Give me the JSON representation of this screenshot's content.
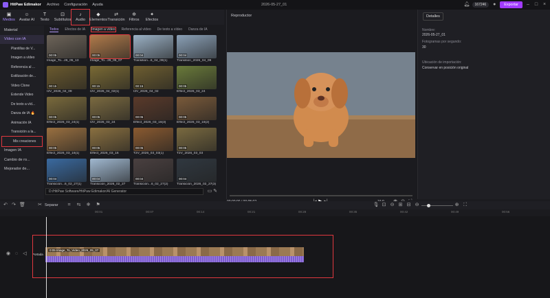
{
  "app": {
    "name": "HitPaw Edimakor",
    "menus": [
      "Archivo",
      "Configuración",
      "Ayuda"
    ],
    "project_title": "2026-05-27_01",
    "credits": "167246",
    "export_label": "Exportar"
  },
  "toolbar": {
    "tools": [
      {
        "label": "Medios",
        "icon": "media-icon"
      },
      {
        "label": "Avatar AI",
        "icon": "avatar-icon"
      },
      {
        "label": "Texto",
        "icon": "text-icon"
      },
      {
        "label": "Subtítulos",
        "icon": "subtitles-icon"
      },
      {
        "label": "Audio",
        "icon": "audio-icon"
      },
      {
        "label": "Elementos",
        "icon": "elements-icon"
      },
      {
        "label": "Transición",
        "icon": "transition-icon"
      },
      {
        "label": "Filtros",
        "icon": "filters-icon"
      },
      {
        "label": "Efectos",
        "icon": "effects-icon"
      }
    ]
  },
  "sidebar": {
    "items": [
      {
        "label": "Material",
        "level": "top"
      },
      {
        "label": "Vídeo con IA",
        "level": "top"
      },
      {
        "label": "Plantillas de V...",
        "level": "sub"
      },
      {
        "label": "Imagen a vídeo",
        "level": "sub"
      },
      {
        "label": "Referencia al ...",
        "level": "sub"
      },
      {
        "label": "Estilización de...",
        "level": "sub"
      },
      {
        "label": "Video Clone",
        "level": "sub"
      },
      {
        "label": "Extende Video",
        "level": "sub"
      },
      {
        "label": "De texto a víd...",
        "level": "sub"
      },
      {
        "label": "Danza de IA 🔥",
        "level": "sub"
      },
      {
        "label": "Animación IA",
        "level": "sub"
      },
      {
        "label": "Transición a la...",
        "level": "sub"
      },
      {
        "label": "Mis creaciones",
        "level": "sub"
      },
      {
        "label": "Imagen IA",
        "level": "top"
      },
      {
        "label": "Cambio de ro...",
        "level": "top"
      },
      {
        "label": "Mejorador de...",
        "level": "top"
      }
    ]
  },
  "subtabs": [
    "Todos",
    "Efectos de IA",
    "Imagen a vídeo",
    "Referencia al vídeo",
    "De texto a vídeo",
    "Danza de IA"
  ],
  "media": [
    {
      "dur": "00:05",
      "name": "Image_To...26_05_13",
      "color": "#6d6459"
    },
    {
      "dur": "00:05",
      "name": "Image_To...26_05_07",
      "color": "#b07a4a"
    },
    {
      "dur": "00:04",
      "name": "Transition...6_04_09(1)",
      "color": "#9ab0c4"
    },
    {
      "dur": "00:04",
      "name": "Transition_2026_04_09",
      "color": "#8aa0b6"
    },
    {
      "dur": "00:15",
      "name": "I2V_2026_04_09",
      "color": "#6b5a2e"
    },
    {
      "dur": "00:15",
      "name": "I2V_2026_04_02(1)",
      "color": "#7a6a34"
    },
    {
      "dur": "00:15",
      "name": "I2V_2026_04_02",
      "color": "#6e5e30"
    },
    {
      "dur": "00:05",
      "name": "Effect_2026_03_24",
      "color": "#6a7a3a"
    },
    {
      "dur": "00:05",
      "name": "Effect_2026_03_24(1)",
      "color": "#7a6a3c"
    },
    {
      "dur": "00:05",
      "name": "I2V_2026_03_24",
      "color": "#7b6a40"
    },
    {
      "dur": "00:05",
      "name": "Effect_2026_03_16(3)",
      "color": "#5a3a2a"
    },
    {
      "dur": "00:05",
      "name": "Effect_2026_03_16(2)",
      "color": "#7a5a3a"
    },
    {
      "dur": "00:05",
      "name": "Effect_2026_03_16(1)",
      "color": "#9a7040"
    },
    {
      "dur": "00:05",
      "name": "Effect_2026_03_16",
      "color": "#8a7040"
    },
    {
      "dur": "00:05",
      "name": "T2V_2026_03_03(1)",
      "color": "#8a5a30"
    },
    {
      "dur": "00:05",
      "name": "T2V_2026_03_03",
      "color": "#7a6a40"
    },
    {
      "dur": "00:04",
      "name": "Transición...6_02_27(1)",
      "color": "#3a6aa0"
    },
    {
      "dur": "00:04",
      "name": "Transición_2026_02_27",
      "color": "#a0b8d0"
    },
    {
      "dur": "00:04",
      "name": "Transición...6_02_27(2)",
      "color": "#4a4040"
    },
    {
      "dur": "00:04",
      "name": "Transición_2026_02_27(3)",
      "color": "#303840"
    }
  ],
  "path": "D:/HitPaw Software/HitPaw Edimakor/AI Generator",
  "player": {
    "title": "Reproductor",
    "time": "00:00:00 / 00:05:02",
    "ratio": "16:9"
  },
  "details": {
    "tab": "Detalles",
    "fields": [
      {
        "label": "Nombre:",
        "value": "2026-05-27_01"
      },
      {
        "label": "Fotogramas por segundo:",
        "value": "30"
      },
      {
        "label": "Ubicación de importación:",
        "value": "Conservar en posición original"
      }
    ]
  },
  "timeline": {
    "split_label": "Separar",
    "ruler": [
      "00:01",
      "00:07",
      "00:14",
      "00:21",
      "00:28",
      "00:35",
      "00:42",
      "00:49",
      "00:56"
    ],
    "track_label": "Portada",
    "clip_label": "0:05 Image_To_Video_2026_05_07"
  }
}
